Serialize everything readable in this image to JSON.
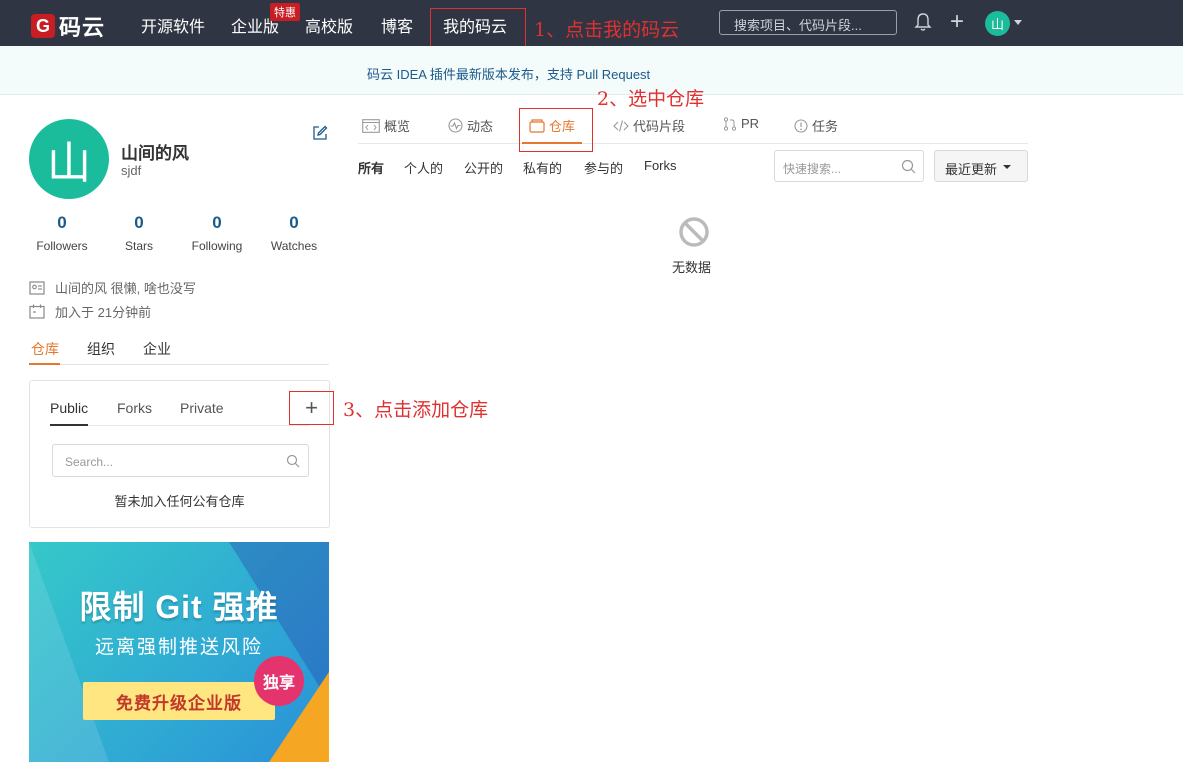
{
  "nav": {
    "logo_text": "码云",
    "logo_mark": "G",
    "items": [
      "开源软件",
      "企业版",
      "高校版",
      "博客",
      "我的码云"
    ],
    "badge": "特惠",
    "search_placeholder": "搜索项目、代码片段...",
    "avatar_char": "山"
  },
  "annotations": {
    "step1": "1、点击我的码云",
    "step2": "2、选中仓库",
    "step3": "3、点击添加仓库"
  },
  "announcement": "码云 IDEA 插件最新版本发布，支持 Pull Request",
  "profile": {
    "avatar_char": "山",
    "name": "山间的风",
    "username": "sjdf",
    "stats": [
      {
        "num": "0",
        "label": "Followers"
      },
      {
        "num": "0",
        "label": "Stars"
      },
      {
        "num": "0",
        "label": "Following"
      },
      {
        "num": "0",
        "label": "Watches"
      }
    ],
    "bio": "山间的风 很懒, 啥也没写",
    "joined": "加入于 21分钟前"
  },
  "left_tabs": [
    "仓库",
    "组织",
    "企业"
  ],
  "repo_card": {
    "tabs": [
      "Public",
      "Forks",
      "Private"
    ],
    "add": "+",
    "search_placeholder": "Search...",
    "empty": "暂未加入任何公有仓库"
  },
  "banner": {
    "title": "限制 Git 强推",
    "subtitle": "远离强制推送风险",
    "button": "免费升级企业版",
    "badge": "独享"
  },
  "main_tabs": [
    "概览",
    "动态",
    "仓库",
    "代码片段",
    "PR",
    "任务"
  ],
  "filters": [
    "所有",
    "个人的",
    "公开的",
    "私有的",
    "参与的",
    "Forks"
  ],
  "quick_search_placeholder": "快速搜索...",
  "sort_label": "最近更新",
  "empty_text": "无数据",
  "colors": {
    "accent": "#e5782c",
    "nav_bg": "#2f3542",
    "brand_red": "#c71d23",
    "avatar_green": "#1bbc9b",
    "annotation_red": "#e03030"
  }
}
